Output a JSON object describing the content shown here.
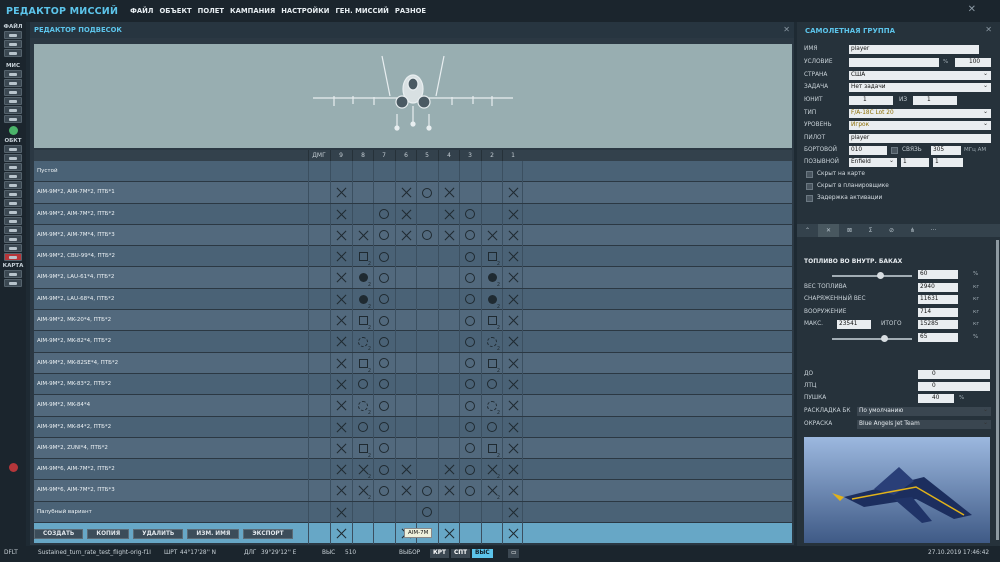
{
  "app": {
    "title": "РЕДАКТОР МИССИЙ",
    "menu": [
      "ФАЙЛ",
      "ОБЪЕКТ",
      "ПОЛЕТ",
      "КАМПАНИЯ",
      "НАСТРОЙКИ",
      "ГЕН. МИССИЙ",
      "РАЗНОЕ"
    ],
    "close_glyph": "✕"
  },
  "left_toolbar": {
    "sections": [
      "ФАЙЛ",
      "МИС",
      "ОБКТ",
      "КАРТА"
    ]
  },
  "editor": {
    "title": "РЕДАКТОР ПОДВЕСОК",
    "close_glyph": "✕",
    "columns": [
      "ДМГ",
      "9",
      "8",
      "7",
      "6",
      "5",
      "4",
      "3",
      "2",
      "1"
    ],
    "rows": [
      {
        "name": "Пустой",
        "cells": [
          "",
          "",
          "",
          "",
          "",
          "",
          "",
          "",
          "",
          ""
        ]
      },
      {
        "name": "AIM-9M*2, AIM-7M*2, ПТБ*1",
        "cells": [
          "",
          "x",
          "",
          "",
          "x",
          "o",
          "x",
          "",
          "",
          "x"
        ]
      },
      {
        "name": "AIM-9M*2, AIM-7M*2, ПТБ*2",
        "cells": [
          "",
          "x",
          "",
          "o",
          "x",
          "",
          "x",
          "o",
          "",
          "x"
        ]
      },
      {
        "name": "AIM-9M*2, AIM-7M*4, ПТБ*3",
        "cells": [
          "",
          "x",
          "x",
          "o",
          "x",
          "o",
          "x",
          "o",
          "x",
          "x"
        ]
      },
      {
        "name": "AIM-9M*2, CBU-99*4, ПТБ*2",
        "cells": [
          "",
          "x",
          "s2",
          "o",
          "",
          "",
          "",
          "o",
          "s2",
          "x"
        ]
      },
      {
        "name": "AIM-9M*2, LAU-61*4, ПТБ*2",
        "cells": [
          "",
          "x",
          "f2",
          "o",
          "",
          "",
          "",
          "o",
          "f2",
          "x"
        ]
      },
      {
        "name": "AIM-9M*2, LAU-68*4, ПТБ*2",
        "cells": [
          "",
          "x",
          "f2",
          "o",
          "",
          "",
          "",
          "o",
          "f2",
          "x"
        ]
      },
      {
        "name": "AIM-9M*2, MK-20*4, ПТБ*2",
        "cells": [
          "",
          "x",
          "s2",
          "o",
          "",
          "",
          "",
          "o",
          "s2",
          "x"
        ]
      },
      {
        "name": "AIM-9M*2, MK-82*4, ПТБ*2",
        "cells": [
          "",
          "x",
          "b2",
          "o",
          "",
          "",
          "",
          "o",
          "b2",
          "x"
        ]
      },
      {
        "name": "AIM-9M*2, MK-82SE*4, ПТБ*2",
        "cells": [
          "",
          "x",
          "s2",
          "o",
          "",
          "",
          "",
          "o",
          "s2",
          "x"
        ]
      },
      {
        "name": "AIM-9M*2, MK-83*2, ПТБ*2",
        "cells": [
          "",
          "x",
          "o",
          "o",
          "",
          "",
          "",
          "o",
          "o",
          "x"
        ]
      },
      {
        "name": "AIM-9M*2, MK-84*4",
        "cells": [
          "",
          "x",
          "b2",
          "o",
          "",
          "",
          "",
          "o",
          "b2",
          "x"
        ]
      },
      {
        "name": "AIM-9M*2, MK-84*2, ПТБ*2",
        "cells": [
          "",
          "x",
          "o",
          "o",
          "",
          "",
          "",
          "o",
          "o",
          "x"
        ]
      },
      {
        "name": "AIM-9M*2, ZUNI*4, ПТБ*2",
        "cells": [
          "",
          "x",
          "s2",
          "o",
          "",
          "",
          "",
          "o",
          "s2",
          "x"
        ]
      },
      {
        "name": "AIM-9M*6, AIM-7M*2, ПТБ*2",
        "cells": [
          "",
          "x",
          "x2",
          "o",
          "x",
          "",
          "x",
          "o",
          "x2",
          "x"
        ]
      },
      {
        "name": "AIM-9M*6, AIM-7M*2, ПТБ*3",
        "cells": [
          "",
          "x",
          "x2",
          "o",
          "x",
          "o",
          "x",
          "o",
          "x2",
          "x"
        ]
      },
      {
        "name": "Палубный вариант",
        "cells": [
          "",
          "x",
          "",
          "",
          "",
          "o",
          "",
          "",
          "",
          "x"
        ]
      },
      {
        "name": "Новая подвеска",
        "cells": [
          "",
          "x",
          "",
          "",
          "x",
          "",
          "x",
          "",
          "",
          "x"
        ],
        "selected": true
      }
    ],
    "tooltip": "AIM-7M",
    "buttons": [
      "СОЗДАТЬ",
      "КОПИЯ",
      "УДАЛИТЬ",
      "ИЗМ. ИМЯ",
      "ЭКСПОРТ"
    ]
  },
  "right_panel": {
    "title": "САМОЛЕТНАЯ ГРУППА",
    "close_glyph": "✕",
    "name_label": "ИМЯ",
    "name_value": "player",
    "condition_label": "УСЛОВИЕ",
    "condition_percent_unit": "%",
    "condition_percent": "100",
    "country_label": "СТРАНА",
    "country_value": "США",
    "task_label": "ЗАДАЧА",
    "task_value": "Нет задачи",
    "unit_label": "ЮНИТ",
    "unit_value": "1",
    "of_label": "ИЗ",
    "of_value": "1",
    "type_label": "ТИП",
    "type_value": "F/A-18C Lot 20",
    "level_label": "УРОВЕНЬ",
    "level_value": "Игрок",
    "pilot_label": "ПИЛОТ",
    "pilot_value": "player",
    "onboard_label": "БОРТОВОЙ",
    "onboard_value": "010",
    "comms_label": "СВЯЗЬ",
    "comms_value": "305",
    "comms_unit": "МГц АМ",
    "callsign_label": "ПОЗЫВНОЙ",
    "callsign_value": "Enfield",
    "callsign_n1": "1",
    "callsign_n2": "1",
    "checkboxes": [
      "Скрыт на карте",
      "Скрыт в планировщике",
      "Задержка активации"
    ],
    "tabs": [
      "⌃",
      "✕",
      "⊠",
      "Σ",
      "⊘",
      "⋔",
      "···"
    ],
    "fuel": {
      "title": "ТОПЛИВО ВО ВНУТР. БАКАХ",
      "fuel_percent": "60",
      "fuel_percent_unit": "%",
      "fuel_weight_label": "ВЕС ТОПЛИВА",
      "fuel_weight": "2940",
      "fuel_weight_unit": "кг",
      "empty_weight_label": "СНАРЯЖЕННЫЙ ВЕС",
      "empty_weight": "11631",
      "empty_weight_unit": "кг",
      "weapons_label": "ВООРУЖЕНИЕ",
      "weapons": "714",
      "weapons_unit": "кг",
      "max_label": "МАКС.",
      "max": "23541",
      "total_label": "ИТОГО",
      "total": "15285",
      "total_unit": "кг",
      "total_percent": "65",
      "total_percent_unit": "%",
      "fuel_slider_level": 0.6,
      "total_slider_level": 0.65
    },
    "do_label": "ДО",
    "do_value": "0",
    "ltc_label": "ЛТЦ",
    "ltc_value": "0",
    "gun_label": "ПУШКА",
    "gun_value": "40",
    "gun_unit": "%",
    "ammo_label": "РАСКЛАДКА БК",
    "ammo_value": "По умолчанию",
    "livery_label": "ОКРАСКА",
    "livery_value": "Blue Angels Jet Team"
  },
  "statusbar": {
    "profile": "DFLT",
    "mission": "Sustained_turn_rate_test_flight-orig-f1l",
    "lat_label": "ШРТ",
    "lat": "44°17'28'' N",
    "lon_label": "ДЛГ",
    "lon": "39°29'12'' E",
    "alt_label": "ВЫС",
    "alt": "510",
    "select_label": "ВЫБОР",
    "modes": [
      "КРТ",
      "СПТ",
      "ВЫС"
    ],
    "active_mode": "ВЫС",
    "datetime": "27.10.2019 17:46:42"
  }
}
